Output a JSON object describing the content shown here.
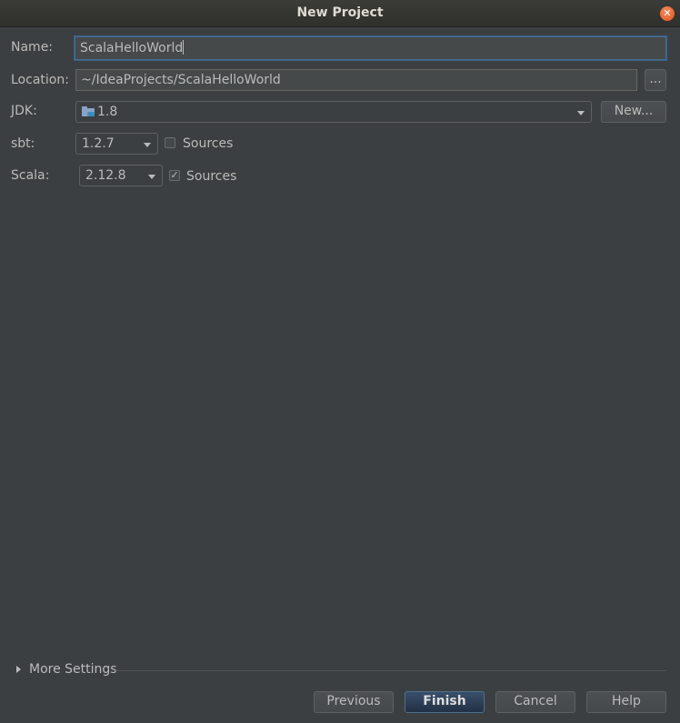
{
  "window": {
    "title": "New Project"
  },
  "form": {
    "name_label": "Name:",
    "name_value": "ScalaHelloWorld",
    "location_label": "Location:",
    "location_value": "~/IdeaProjects/ScalaHelloWorld",
    "browse_label": "...",
    "jdk_label": "JDK:",
    "jdk_value": "1.8",
    "jdk_new_label": "New...",
    "sbt_label": "sbt:",
    "sbt_version": "1.2.7",
    "sbt_sources_label": "Sources",
    "sbt_sources_checked": false,
    "scala_label": "Scala:",
    "scala_version": "2.12.8",
    "scala_sources_label": "Sources",
    "scala_sources_checked": true
  },
  "more_settings": {
    "label": "More Settings"
  },
  "footer": {
    "previous_label": "Previous",
    "finish_label": "Finish",
    "cancel_label": "Cancel",
    "help_label": "Help"
  },
  "icons": {
    "close": "close-icon",
    "jdk": "folder-icon",
    "expand": "triangle-right-icon"
  },
  "colors": {
    "background": "#3c3f41",
    "accent": "#466d94",
    "close": "#e0531e"
  }
}
